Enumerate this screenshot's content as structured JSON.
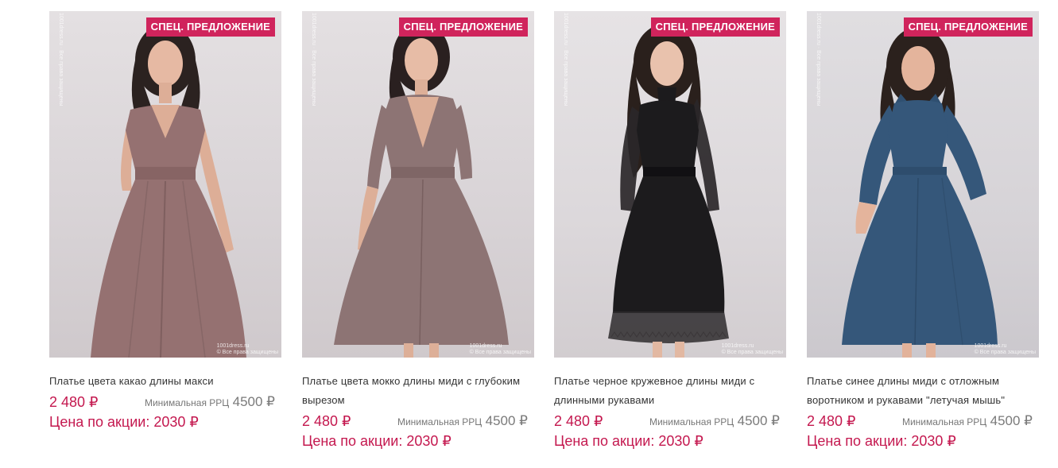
{
  "products": [
    {
      "badge": "СПЕЦ. ПРЕДЛОЖЕНИЕ",
      "watermark_side": "1001dress.ru · Все права защищены",
      "watermark_corner_1": "1001dress.ru",
      "watermark_corner_2": "© Все права защищены",
      "title": "Платье цвета какао длины макси",
      "price": "2 480 ₽",
      "rrc_label": "Минимальная РРЦ",
      "rrc_value": "4500 ₽",
      "promo": "Цена по акции: 2030 ₽",
      "dress_color": "#957171"
    },
    {
      "badge": "СПЕЦ. ПРЕДЛОЖЕНИЕ",
      "watermark_side": "1001dress.ru · Все права защищены",
      "watermark_corner_1": "1001dress.ru",
      "watermark_corner_2": "© Все права защищены",
      "title": "Платье цвета мокко длины миди с глубоким вырезом",
      "price": "2 480 ₽",
      "rrc_label": "Минимальная РРЦ",
      "rrc_value": "4500 ₽",
      "promo": "Цена по акции: 2030 ₽",
      "dress_color": "#8d7474"
    },
    {
      "badge": "СПЕЦ. ПРЕДЛОЖЕНИЕ",
      "watermark_side": "1001dress.ru · Все права защищены",
      "watermark_corner_1": "1001dress.ru",
      "watermark_corner_2": "© Все права защищены",
      "title": "Платье черное кружевное длины миди с длинными рукавами",
      "price": "2 480 ₽",
      "rrc_label": "Минимальная РРЦ",
      "rrc_value": "4500 ₽",
      "promo": "Цена по акции: 2030 ₽",
      "dress_color": "#1c1b1d"
    },
    {
      "badge": "СПЕЦ. ПРЕДЛОЖЕНИЕ",
      "watermark_side": "1001dress.ru · Все права защищены",
      "watermark_corner_1": "1001dress.ru",
      "watermark_corner_2": "© Все права защищены",
      "title": "Платье синее длины миди с отложным воротником и рукавами \"летучая мышь\"",
      "price": "2 480 ₽",
      "rrc_label": "Минимальная РРЦ",
      "rrc_value": "4500 ₽",
      "promo": "Цена по акции: 2030 ₽",
      "dress_color": "#35577a"
    }
  ],
  "colors": {
    "badge_bg": "#d0245c",
    "price": "#c4184f",
    "text": "#333333",
    "muted": "#777777"
  }
}
